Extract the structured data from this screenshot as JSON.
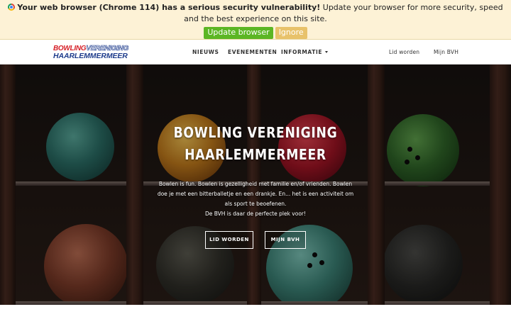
{
  "banner": {
    "icon": "chrome-icon",
    "bold_text": "Your web browser (Chrome 114) has a serious security vulnerability!",
    "text": " Update your browser for more security, speed and the best experience on this site.",
    "update_label": "Update browser",
    "ignore_label": "Ignore"
  },
  "logo": {
    "line1_word1": "BOWLING",
    "line1_word2": "VERENIGING",
    "line2": "HAARLEMMERMEER"
  },
  "nav": {
    "items": [
      {
        "label": "NIEUWS"
      },
      {
        "label": "EVENEMENTEN"
      },
      {
        "label": "INFORMATIE",
        "dropdown": true
      }
    ],
    "right": [
      {
        "label": "Lid worden"
      },
      {
        "label": "Mijn BVH"
      }
    ]
  },
  "hero": {
    "title_line1": "BOWLING VERENIGING",
    "title_line2": "HAARLEMMERMEER",
    "text_lines": [
      "Bowlen is fun. Bowlen is gezelligheid met familie en/of vrienden. Bowlen",
      "doe je met een bitterballetje en een drankje. En... het is een activiteit om",
      "als sport te beoefenen.",
      "De BVH is daar de perfecte plek voor!"
    ],
    "button_join": "LID WORDEN",
    "button_account": "MIJN BVH"
  },
  "colors": {
    "update_green": "#5cb624",
    "ignore_gold": "#e8c26a",
    "banner_bg": "#fdf2d6",
    "logo_red": "#d62028",
    "logo_blue": "#1e3c8c"
  }
}
